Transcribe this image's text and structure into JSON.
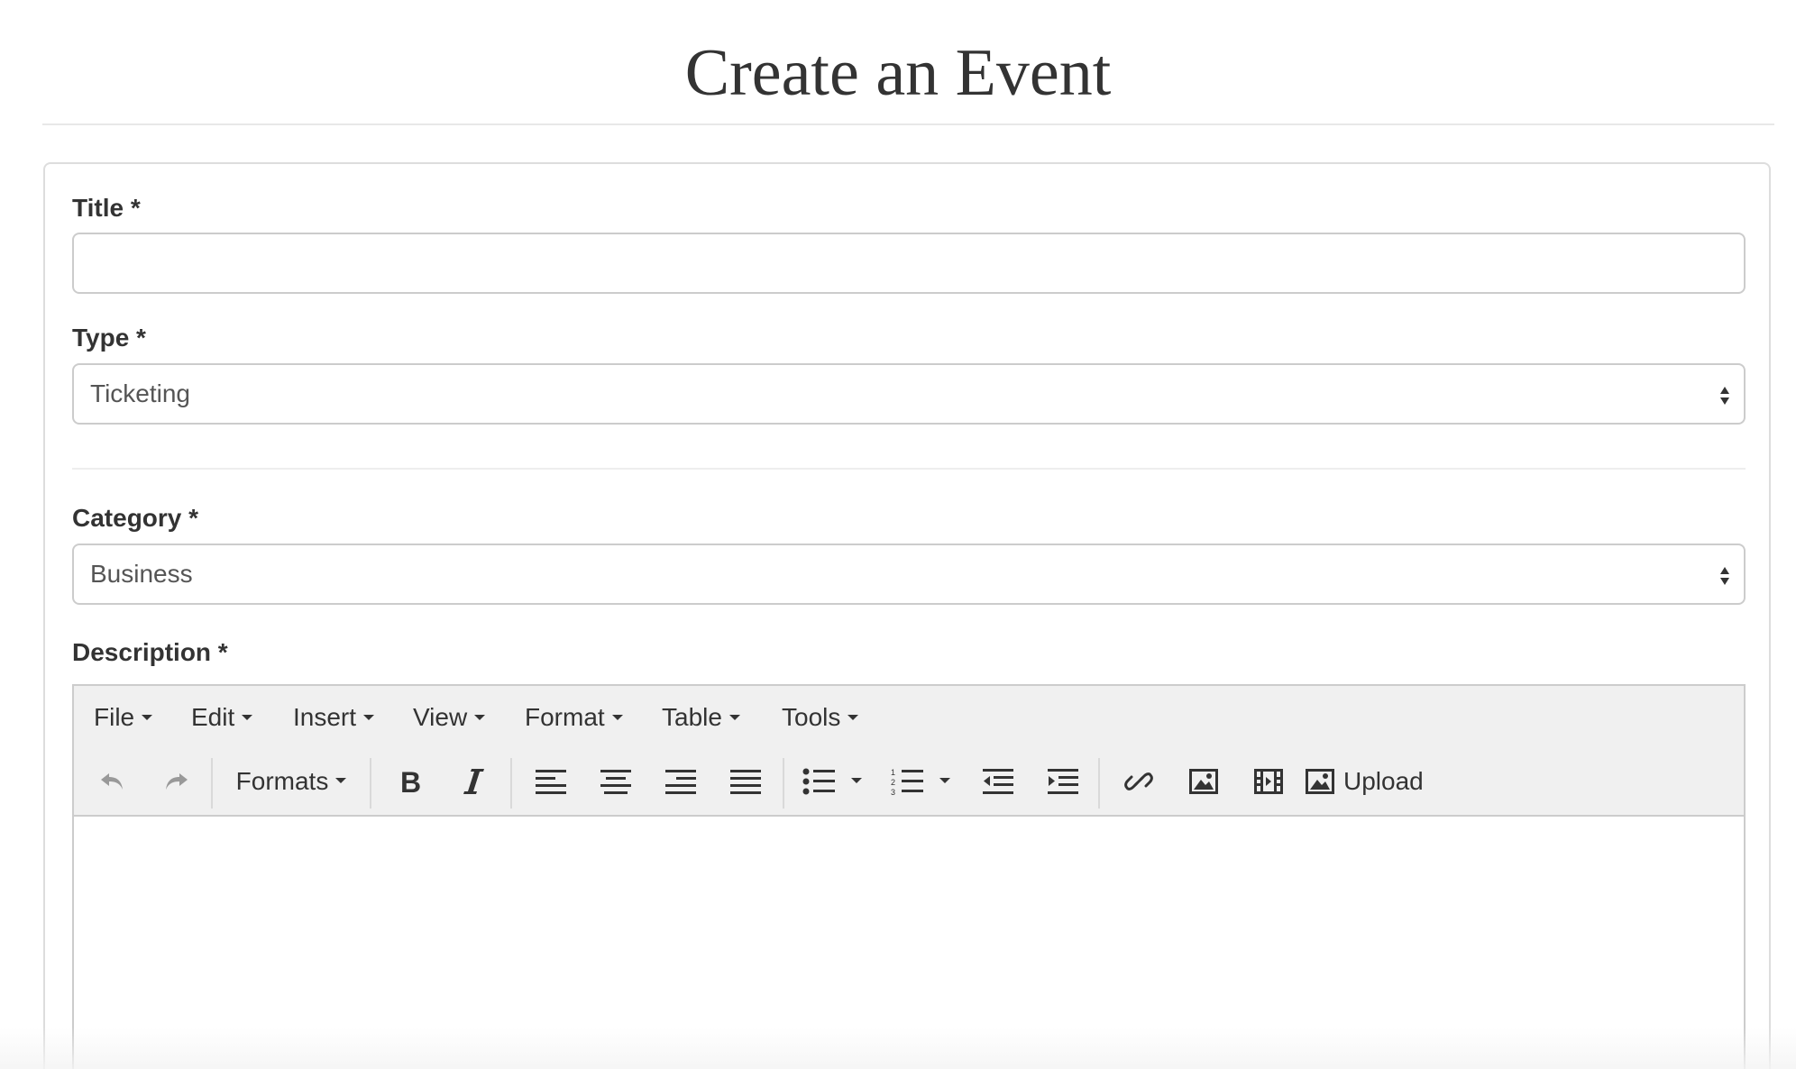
{
  "page": {
    "title": "Create an Event"
  },
  "form": {
    "title_field": {
      "label": "Title *",
      "value": "",
      "placeholder": ""
    },
    "type_field": {
      "label": "Type *",
      "selected": "Ticketing"
    },
    "category_field": {
      "label": "Category *",
      "selected": "Business"
    },
    "description_field": {
      "label": "Description *"
    }
  },
  "editor": {
    "menubar": [
      {
        "label": "File"
      },
      {
        "label": "Edit"
      },
      {
        "label": "Insert"
      },
      {
        "label": "View"
      },
      {
        "label": "Format"
      },
      {
        "label": "Table"
      },
      {
        "label": "Tools"
      }
    ],
    "toolbar": {
      "formats_label": "Formats",
      "upload_label": "Upload",
      "icons": [
        "undo-icon",
        "redo-icon",
        "bold-icon",
        "italic-icon",
        "align-left-icon",
        "align-center-icon",
        "align-right-icon",
        "align-justify-icon",
        "bullet-list-icon",
        "numbered-list-icon",
        "outdent-icon",
        "indent-icon",
        "link-icon",
        "image-icon",
        "media-icon",
        "upload-image-icon"
      ]
    },
    "content": ""
  },
  "colors": {
    "text": "#333333",
    "border": "#cccccc",
    "toolbar_bg": "#f0f0f0",
    "disabled_icon": "#999999"
  }
}
